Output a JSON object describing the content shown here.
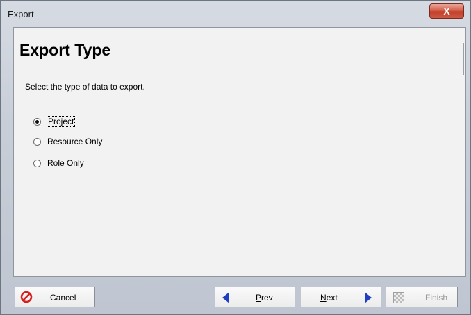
{
  "window": {
    "title": "Export",
    "close_label": "X"
  },
  "page": {
    "heading": "Export Type",
    "instruction": "Select the type of data to export."
  },
  "options": [
    {
      "label": "Project",
      "selected": true
    },
    {
      "label": "Resource Only",
      "selected": false
    },
    {
      "label": "Role Only",
      "selected": false
    }
  ],
  "buttons": {
    "cancel": "Cancel",
    "prev_mnemonic": "P",
    "prev_rest": "rev",
    "next_mnemonic": "N",
    "next_rest": "ext",
    "finish": "Finish"
  },
  "icons": {
    "cancel": "no-entry-icon",
    "prev": "left-triangle-arrow-icon",
    "next": "right-triangle-arrow-icon",
    "finish": "checkered-flag-icon"
  },
  "colors": {
    "arrow": "#1f3fbf",
    "cancel_icon": "#d62020"
  }
}
